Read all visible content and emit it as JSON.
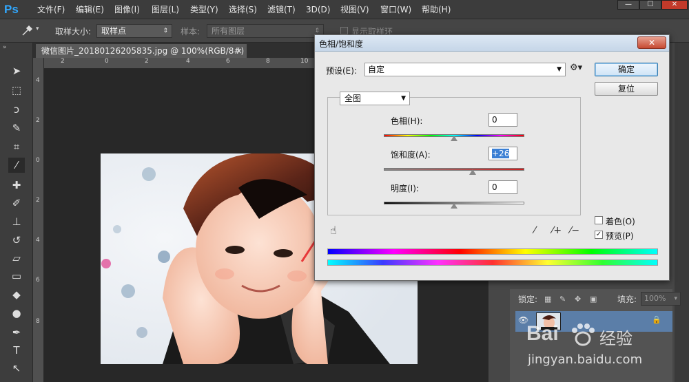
{
  "app": {
    "logo": "Ps"
  },
  "menu": [
    "文件(F)",
    "编辑(E)",
    "图像(I)",
    "图层(L)",
    "类型(Y)",
    "选择(S)",
    "滤镜(T)",
    "3D(D)",
    "视图(V)",
    "窗口(W)",
    "帮助(H)"
  ],
  "window_controls": {
    "minimize": "—",
    "restore": "☐",
    "close": "✕"
  },
  "options_bar": {
    "sample_size_label": "取样大小:",
    "sample_size_value": "取样点",
    "sample_label": "样本:",
    "sample_value": "所有图层",
    "show_ring_label": "显示取样环"
  },
  "document": {
    "tab_title": "微信图片_20180126205835.jpg @ 100%(RGB/8#) *",
    "close": "×",
    "ruler_top": [
      "2",
      "0",
      "2",
      "4",
      "6",
      "8",
      "10"
    ],
    "ruler_left": [
      "4",
      "2",
      "0",
      "2",
      "4",
      "6",
      "8"
    ]
  },
  "layers_panel": {
    "lock_label": "锁定:",
    "fill_label": "填充:",
    "fill_value": "100%"
  },
  "dialog": {
    "title": "色相/饱和度",
    "close": "✕",
    "preset_label": "预设(E):",
    "preset_value": "自定",
    "ok": "确定",
    "reset": "复位",
    "channel_value": "全图",
    "hue_label": "色相(H):",
    "hue_value": "0",
    "hue_level": 0.5,
    "saturation_label": "饱和度(A):",
    "saturation_value": "+26",
    "saturation_level": 0.63,
    "lightness_label": "明度(I):",
    "lightness_value": "0",
    "lightness_level": 0.5,
    "colorize_label": "着色(O)",
    "colorize_checked": false,
    "preview_label": "预览(P)",
    "preview_checked": true
  },
  "watermark": {
    "brand": "Bai",
    "brand_suffix": "经验",
    "url": "jingyan.baidu.com"
  },
  "colors": {
    "accent_blue": "#31a8ff",
    "annotation_arrow": "#e8383a"
  }
}
